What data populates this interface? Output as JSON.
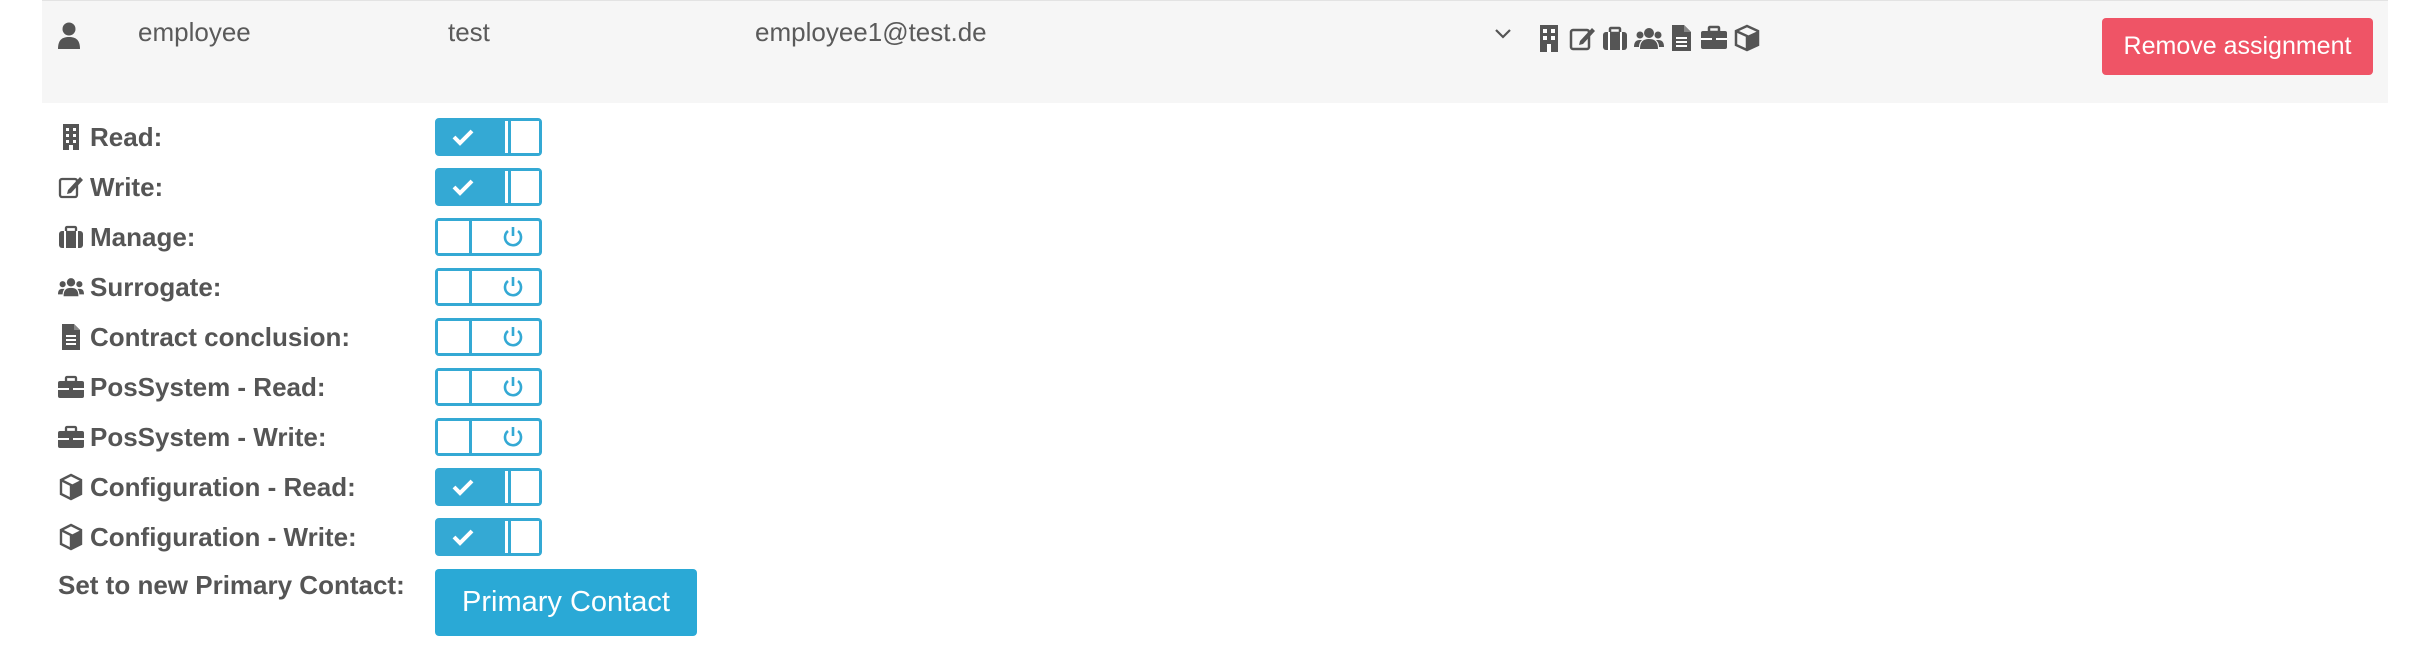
{
  "assignment": {
    "first_name": "employee",
    "last_name": "test",
    "email": "employee1@test.de",
    "remove_label": "Remove assignment",
    "summary_icons": [
      "building-icon",
      "edit-icon",
      "suitcase-icon",
      "users-icon",
      "file-icon",
      "briefcase-icon",
      "cube-icon"
    ]
  },
  "permissions": [
    {
      "label": "Read:",
      "icon": "building-icon",
      "enabled": true
    },
    {
      "label": "Write:",
      "icon": "edit-icon",
      "enabled": true
    },
    {
      "label": "Manage:",
      "icon": "suitcase-icon",
      "enabled": false
    },
    {
      "label": "Surrogate:",
      "icon": "users-icon",
      "enabled": false
    },
    {
      "label": "Contract conclusion:",
      "icon": "file-icon",
      "enabled": false
    },
    {
      "label": "PosSystem - Read:",
      "icon": "briefcase-icon",
      "enabled": false
    },
    {
      "label": "PosSystem - Write:",
      "icon": "briefcase-icon",
      "enabled": false
    },
    {
      "label": "Configuration - Read:",
      "icon": "cube-icon",
      "enabled": true
    },
    {
      "label": "Configuration - Write:",
      "icon": "cube-icon",
      "enabled": true
    }
  ],
  "primary_contact": {
    "label": "Set to new Primary Contact:",
    "button_label": "Primary Contact"
  },
  "colors": {
    "accent": "#34a9d4",
    "danger": "#ef5466",
    "row_background": "#f6f6f6",
    "text": "#555555"
  }
}
